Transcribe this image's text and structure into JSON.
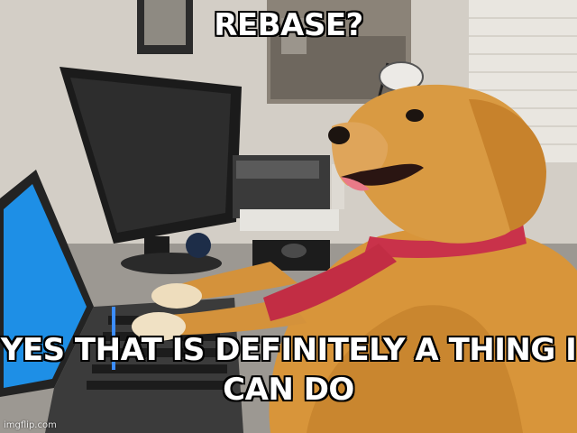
{
  "meme": {
    "top_text": "REBASE?",
    "bottom_text": "YES THAT IS DEFINITELY A THING I CAN DO",
    "watermark": "imgflip.com"
  },
  "scene": {
    "subject": "golden retriever wearing a red tie, paws on a laptop keyboard, desktop monitor and printer in background",
    "colors": {
      "fur": "#d8953a",
      "fur_shadow": "#b8742a",
      "tie": "#c9324a",
      "laptop_screen": "#1e8fe6",
      "monitor": "#1a1a1a",
      "wall": "#d4cfc7"
    }
  }
}
